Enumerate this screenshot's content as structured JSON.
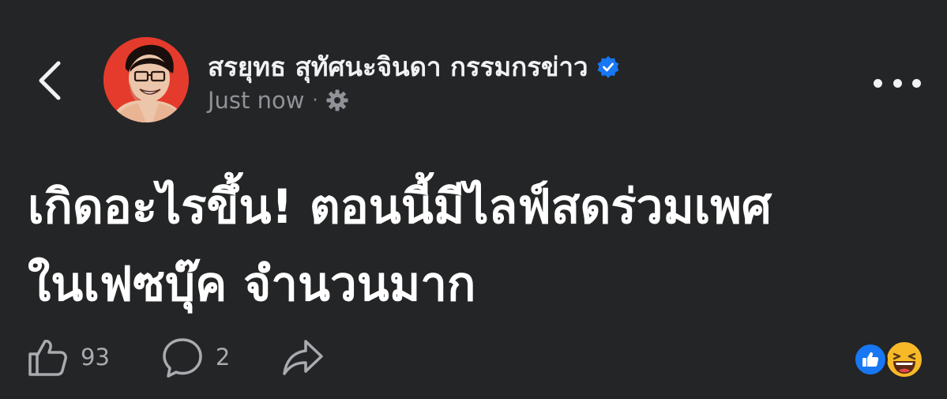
{
  "post": {
    "author_name": "สรยุทธ สุทัศนะจินดา กรรมกรข่าว",
    "timestamp": "Just now",
    "separator": "·",
    "text_lines": [
      "เกิดอะไรขึ้น! ตอนนี้มีไลฟ์สดร่วมเพศ",
      "ในเฟซบุ๊ค จำนวนมาก"
    ]
  },
  "actions": {
    "like_count": "93",
    "comment_count": "2"
  },
  "icons": {
    "back": "chevron-left-icon",
    "verified": "verified-badge-icon",
    "audience": "gear-icon",
    "more": "more-horizontal-icon",
    "like": "thumbs-up-icon",
    "comment": "comment-bubble-icon",
    "share": "share-arrow-icon",
    "reaction_like": "like-reaction-icon",
    "reaction_haha": "haha-reaction-icon"
  },
  "colors": {
    "background": "#242526",
    "text": "#ffffff",
    "meta": "#8f9296",
    "verified_blue": "#1877f2",
    "avatar_red": "#e53b2c",
    "haha_yellow": "#f7b928"
  }
}
